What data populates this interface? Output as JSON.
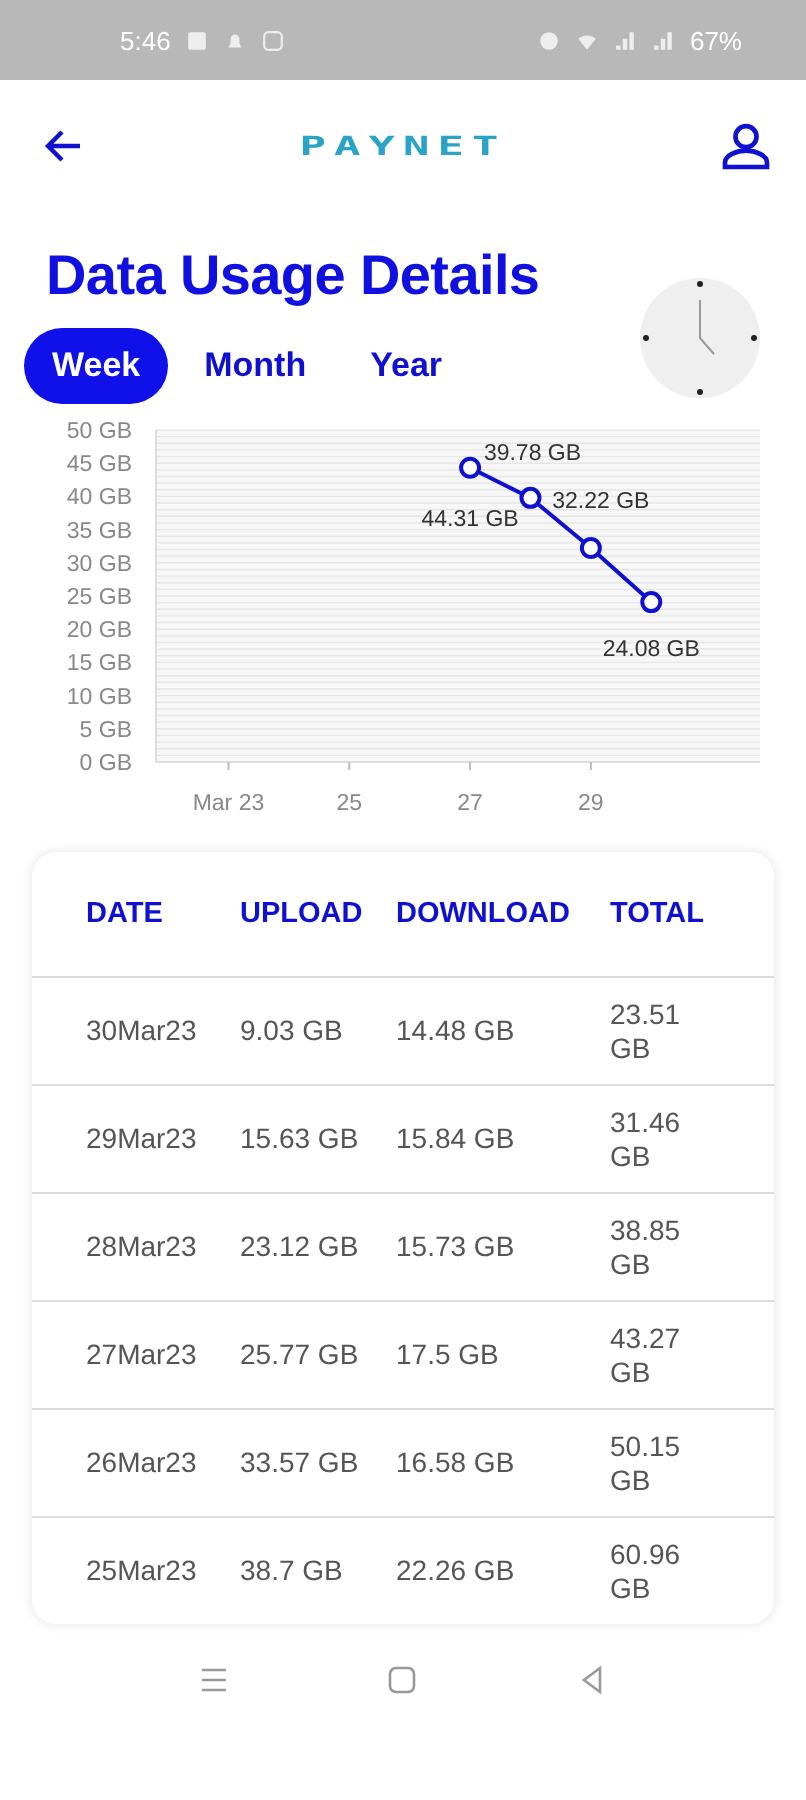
{
  "status_bar": {
    "time": "5:46",
    "battery": "67%"
  },
  "header": {
    "logo": "PAYNET"
  },
  "title": "Data Usage Details",
  "tabs": [
    {
      "label": "Week",
      "selected": true
    },
    {
      "label": "Month",
      "selected": false
    },
    {
      "label": "Year",
      "selected": false
    }
  ],
  "chart": {
    "chart_data": {
      "type": "line",
      "x": [
        27,
        28,
        29,
        30
      ],
      "grid": true,
      "xticks": [
        {
          "value": 23,
          "label": "Mar 23"
        },
        {
          "value": 25,
          "label": "25"
        },
        {
          "value": 27,
          "label": "27"
        },
        {
          "value": 29,
          "label": "29"
        }
      ],
      "yticks": [
        {
          "value": 0,
          "label": "0 GB"
        },
        {
          "value": 5,
          "label": "5 GB"
        },
        {
          "value": 10,
          "label": "10 GB"
        },
        {
          "value": 15,
          "label": "15 GB"
        },
        {
          "value": 20,
          "label": "20 GB"
        },
        {
          "value": 25,
          "label": "25 GB"
        },
        {
          "value": 30,
          "label": "30 GB"
        },
        {
          "value": 35,
          "label": "35 GB"
        },
        {
          "value": 40,
          "label": "40 GB"
        },
        {
          "value": 45,
          "label": "45 GB"
        },
        {
          "value": 50,
          "label": "50 GB"
        }
      ],
      "xlim": [
        21.8,
        31.8
      ],
      "ylim": [
        0,
        50
      ],
      "series": [
        {
          "color": "#1010d0",
          "marker": "circle",
          "values": [
            44.31,
            39.78,
            32.22,
            24.08
          ]
        }
      ],
      "value_labels": [
        "44.31 GB",
        "39.78 GB",
        "32.22 GB",
        "24.08 GB"
      ]
    }
  },
  "table": {
    "columns": [
      "DATE",
      "UPLOAD",
      "DOWNLOAD",
      "TOTAL"
    ],
    "rows": [
      [
        "30Mar23",
        "9.03 GB",
        "14.48 GB",
        "23.51 GB"
      ],
      [
        "29Mar23",
        "15.63 GB",
        "15.84 GB",
        "31.46 GB"
      ],
      [
        "28Mar23",
        "23.12 GB",
        "15.73 GB",
        "38.85 GB"
      ],
      [
        "27Mar23",
        "25.77 GB",
        "17.5 GB",
        "43.27 GB"
      ],
      [
        "26Mar23",
        "33.57 GB",
        "16.58 GB",
        "50.15 GB"
      ],
      [
        "25Mar23",
        "38.7 GB",
        "22.26 GB",
        "60.96 GB"
      ]
    ]
  }
}
